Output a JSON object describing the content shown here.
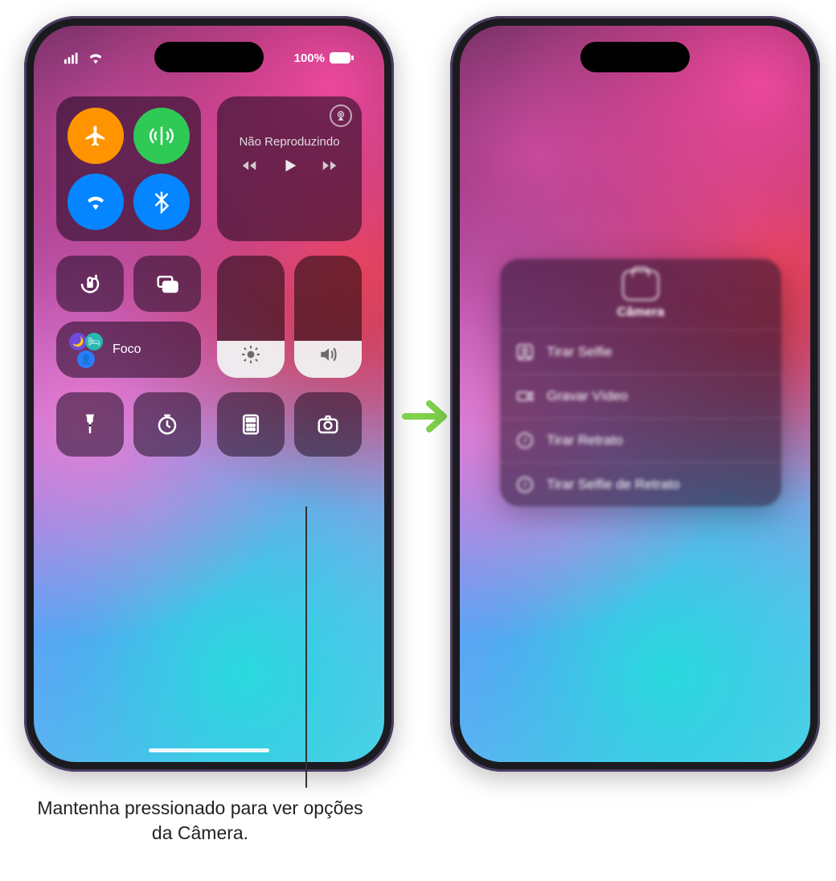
{
  "status": {
    "battery_pct": "100%"
  },
  "connectivity": {
    "airplane": "airplane-icon",
    "cellular": "antenna-icon",
    "wifi": "wifi-icon",
    "bluetooth": "bluetooth-icon"
  },
  "media": {
    "title": "Não Reproduzindo",
    "airplay": "airplay-icon"
  },
  "focus": {
    "label": "Foco"
  },
  "sliders": {
    "brightness_pct": 30,
    "volume_pct": 30
  },
  "quick_buttons": {
    "flashlight": "flashlight-icon",
    "timer": "timer-icon",
    "calculator": "calculator-icon",
    "camera": "camera-icon",
    "orientation_lock": "orientation-lock-icon",
    "screen_mirroring": "screen-mirroring-icon"
  },
  "camera_menu": {
    "title": "Câmera",
    "items": [
      {
        "icon": "person-square-icon",
        "label": "Tirar Selfie"
      },
      {
        "icon": "video-icon",
        "label": "Gravar Vídeo"
      },
      {
        "icon": "aperture-icon",
        "label": "Tirar Retrato"
      },
      {
        "icon": "aperture-icon",
        "label": "Tirar Selfie de Retrato"
      }
    ]
  },
  "callout": "Mantenha pressionado para ver opções da Câmera."
}
